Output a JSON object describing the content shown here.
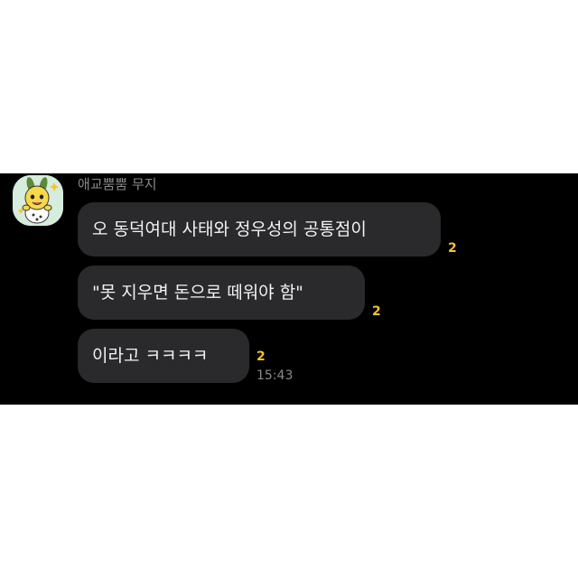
{
  "sender": {
    "name": "애교뿜뿜 무지",
    "avatar_icon": "muzi-character-avatar-icon"
  },
  "messages": [
    {
      "text": "오 동덕여대 사태와 정우성의 공통점이",
      "unread_count": "2"
    },
    {
      "text": "\"못 지우면 돈으로 떼워야 함\"",
      "unread_count": "2"
    },
    {
      "text": "이라고 ㅋㅋㅋㅋ",
      "unread_count": "2"
    }
  ],
  "timestamp": "15:43",
  "colors": {
    "chat_background": "#000000",
    "bubble": "#2a2a2c",
    "unread_badge": "#f4c22b",
    "avatar_background": "#d6ecdc"
  }
}
